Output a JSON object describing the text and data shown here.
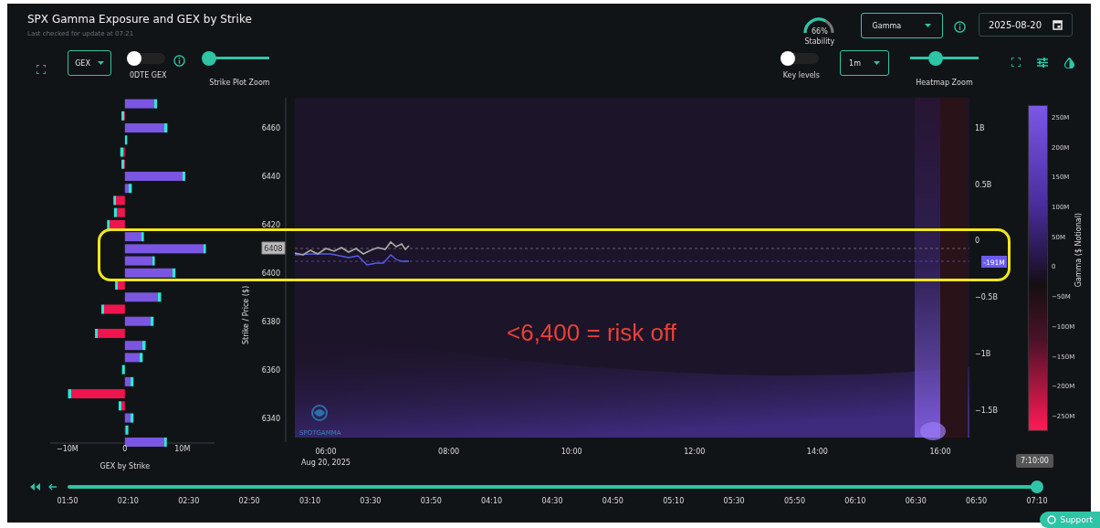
{
  "header": {
    "title": "SPX Gamma Exposure and GEX by Strike",
    "subtitle": "Last checked for update at 07:21"
  },
  "stability": {
    "value": "66%",
    "label": "Stability"
  },
  "view_select": {
    "value": "Gamma"
  },
  "date_field": {
    "value": "2025-08-20"
  },
  "left_controls": {
    "metric_select": {
      "value": "GEX"
    },
    "dte_toggle": {
      "label": "0DTE GEX",
      "on": false
    },
    "strike_zoom": {
      "label": "Strike Plot Zoom",
      "level": 0
    }
  },
  "right_controls": {
    "key_levels": {
      "label": "Key levels",
      "on": false
    },
    "interval_select": {
      "value": "1m"
    },
    "heatmap_zoom": {
      "label": "Heatmap Zoom",
      "level": 0.37
    }
  },
  "gex_chart": {
    "chart_data": {
      "type": "bar",
      "orientation": "horizontal",
      "x": [
        6470,
        6465,
        6460,
        6455,
        6450,
        6445,
        6440,
        6435,
        6430,
        6425,
        6420,
        6415,
        6410,
        6405,
        6400,
        6395,
        6390,
        6385,
        6380,
        6375,
        6370,
        6365,
        6360,
        6355,
        6350,
        6345,
        6340,
        6335,
        6330
      ],
      "values": [
        5.6,
        -0.6,
        7.4,
        0.4,
        -0.8,
        -0.6,
        10.5,
        1.2,
        -2.0,
        -1.9,
        -3.1,
        3.3,
        14.1,
        5.2,
        8.8,
        -1.7,
        6.3,
        -4.1,
        5.0,
        -5.2,
        3.6,
        3.1,
        -0.5,
        1.5,
        -9.9,
        -1.1,
        1.5,
        0.6,
        7.3
      ],
      "xlabel": "GEX by Strike",
      "xticks": [
        {
          "value": -10,
          "label": "−10M"
        },
        {
          "value": 0,
          "label": "0"
        },
        {
          "value": 10,
          "label": "10M"
        }
      ],
      "xlim": [
        -13,
        15.6
      ],
      "ylabel": "Strike / Price ($)",
      "yticks": [
        6460,
        6440,
        6420,
        6400,
        6380,
        6360,
        6340
      ],
      "ylim": [
        6330,
        6472.5
      ]
    }
  },
  "heatmap": {
    "time_ticks": [
      "06:00",
      "08:00",
      "10:00",
      "12:00",
      "14:00",
      "16:00"
    ],
    "date_label": "Aug 20, 2025",
    "net_ticks": [
      "1B",
      "0.5B",
      "0",
      "−0.5B",
      "−1B",
      "−1.5B"
    ],
    "price_badge": "6408",
    "net_badge": "-191M",
    "logo_text": "SPOTGAMMA"
  },
  "color_scale": {
    "title": "Gamma ($ Notional)",
    "ticks": [
      "250M",
      "200M",
      "150M",
      "100M",
      "50M",
      "0",
      "−50M",
      "−100M",
      "−150M",
      "−200M",
      "−250M"
    ]
  },
  "annotation": {
    "text": "<6,400 = risk off"
  },
  "timeline": {
    "current": "7:10:00",
    "level": 1,
    "ticks": [
      "01:50",
      "02:10",
      "02:30",
      "02:50",
      "03:10",
      "03:30",
      "03:50",
      "04:10",
      "04:30",
      "04:50",
      "05:10",
      "05:30",
      "05:50",
      "06:10",
      "06:30",
      "06:50",
      "07:10"
    ]
  },
  "support_button": {
    "label": "Support"
  }
}
